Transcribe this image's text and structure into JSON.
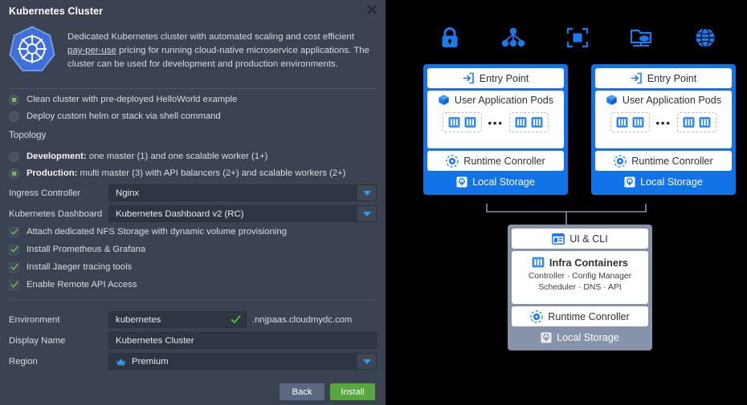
{
  "dialog": {
    "title": "Kubernetes Cluster",
    "close_icon": "close-icon",
    "logo_icon": "kubernetes-logo-icon",
    "description_part1": "Dedicated Kubernetes cluster with automated scaling and cost efficient ",
    "description_link": "pay-per-use",
    "description_part2": " pricing for running cloud-native microservice applications. The cluster can be used for development and production environments.",
    "cluster_type_options": [
      {
        "label": "Clean cluster with pre-deployed HelloWorld example",
        "selected": true
      },
      {
        "label": "Deploy custom helm or stack via shell command",
        "selected": false
      }
    ],
    "topology_label": "Topology",
    "topology_options": [
      {
        "bold": "Development:",
        "rest": " one master (1) and one scalable worker (1+)",
        "selected": false
      },
      {
        "bold": "Production:",
        "rest": " multi master (3) with API balancers (2+) and scalable workers (2+)",
        "selected": true
      }
    ],
    "ingress_controller": {
      "label": "Ingress Controller",
      "value": "Nginx"
    },
    "kubernetes_dashboard": {
      "label": "Kubernetes Dashboard",
      "value": "Kubernetes Dashboard v2 (RC)"
    },
    "addons": [
      {
        "label": "Attach dedicated NFS Storage with dynamic volume provisioning",
        "checked": true
      },
      {
        "label": "Install Prometheus & Grafana",
        "checked": true
      },
      {
        "label": "Install Jaeger tracing tools",
        "checked": true
      },
      {
        "label": "Enable Remote API Access",
        "checked": true
      }
    ],
    "environment": {
      "label": "Environment",
      "value": "kubernetes",
      "suffix": ".nnjpaas.cloudmydc.com",
      "valid_icon": "check-icon"
    },
    "display_name": {
      "label": "Display Name",
      "value": "Kubernetes Cluster"
    },
    "region": {
      "label": "Region",
      "value": "Premium",
      "icon": "crown-icon"
    },
    "back_button": "Back",
    "install_button": "Install",
    "accent_blue": "#2f9ceb",
    "accent_green": "#6fbf4e",
    "install_green": "#56a83c",
    "back_gray": "#5c6781",
    "background": "#3b4352"
  },
  "diagram": {
    "top_icons": [
      {
        "name": "lock-icon",
        "label": "security"
      },
      {
        "name": "network-topology-icon",
        "label": "topology"
      },
      {
        "name": "scaling-icon",
        "label": "scaling"
      },
      {
        "name": "cloud-storage-icon",
        "label": "storage"
      },
      {
        "name": "globe-icon",
        "label": "network"
      }
    ],
    "worker_clusters": [
      {
        "entry_point": "Entry Point",
        "pods_title": "User Application Pods",
        "pods_left_count": 2,
        "pods_right_count": 2,
        "pods_ellipsis": "•••",
        "runtime": "Runtime Conroller",
        "storage": "Local Storage"
      },
      {
        "entry_point": "Entry Point",
        "pods_title": "User Application Pods",
        "pods_left_count": 2,
        "pods_right_count": 2,
        "pods_ellipsis": "•••",
        "runtime": "Runtime Conroller",
        "storage": "Local Storage"
      }
    ],
    "control_plane": {
      "ui_cli": "UI & CLI",
      "infra_title": "Infra Containers",
      "infra_line1": "Controller · Config Manager",
      "infra_line2": "Scheduler · DNS · API",
      "runtime": "Runtime Conroller",
      "storage": "Local Storage"
    },
    "colors": {
      "worker_border": "#1273e8",
      "control_border": "#8793ab",
      "icon_blue": "#1a7bf0",
      "background": "#000000"
    }
  }
}
